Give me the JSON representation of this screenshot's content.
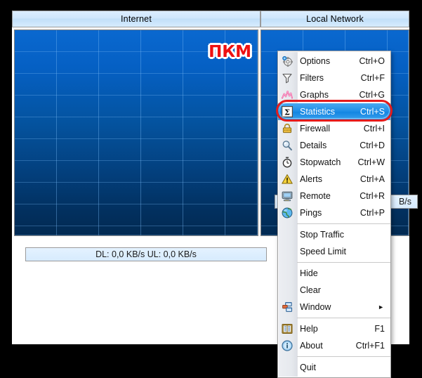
{
  "app": {
    "tabs": [
      {
        "id": "internet",
        "label": "Internet"
      },
      {
        "id": "local",
        "label": "Local Network"
      }
    ],
    "overlay_label": "ПКМ",
    "status": {
      "internet": "DL: 0,0 KB/s   UL: 0,0 KB/s",
      "local_partial": "B/s"
    },
    "colors": {
      "graph_top": "#0a68cf",
      "graph_bottom": "#022a52",
      "gridline": "#78b9f5",
      "tab_bg": "#cfe6fb",
      "status_bg": "#d7ebfe",
      "menu_bg": "#ffffff",
      "menu_gutter": "#e6e9ee",
      "selection": "#1f8ee6",
      "highlight_ring": "#e51b1b",
      "overlay_text": "#ee1111",
      "frame": "#000000"
    }
  },
  "context_menu": {
    "items": [
      {
        "label": "Options",
        "accel": "Ctrl+O",
        "icon": "gear-icon",
        "selected": false,
        "separator_after": false,
        "submenu": false
      },
      {
        "label": "Filters",
        "accel": "Ctrl+F",
        "icon": "funnel-icon",
        "selected": false,
        "separator_after": false,
        "submenu": false
      },
      {
        "label": "Graphs",
        "accel": "Ctrl+G",
        "icon": "chart-icon",
        "selected": false,
        "separator_after": false,
        "submenu": false
      },
      {
        "label": "Statistics",
        "accel": "Ctrl+S",
        "icon": "sigma-icon",
        "selected": true,
        "separator_after": false,
        "submenu": false
      },
      {
        "label": "Firewall",
        "accel": "Ctrl+I",
        "icon": "padlock-icon",
        "selected": false,
        "separator_after": false,
        "submenu": false
      },
      {
        "label": "Details",
        "accel": "Ctrl+D",
        "icon": "magnifier-icon",
        "selected": false,
        "separator_after": false,
        "submenu": false
      },
      {
        "label": "Stopwatch",
        "accel": "Ctrl+W",
        "icon": "stopwatch-icon",
        "selected": false,
        "separator_after": false,
        "submenu": false
      },
      {
        "label": "Alerts",
        "accel": "Ctrl+A",
        "icon": "warning-icon",
        "selected": false,
        "separator_after": false,
        "submenu": false
      },
      {
        "label": "Remote",
        "accel": "Ctrl+R",
        "icon": "monitor-icon",
        "selected": false,
        "separator_after": false,
        "submenu": false
      },
      {
        "label": "Pings",
        "accel": "Ctrl+P",
        "icon": "globe-icon",
        "selected": false,
        "separator_after": true,
        "submenu": false
      },
      {
        "label": "Stop Traffic",
        "accel": "",
        "icon": "",
        "selected": false,
        "separator_after": false,
        "submenu": false
      },
      {
        "label": "Speed Limit",
        "accel": "",
        "icon": "",
        "selected": false,
        "separator_after": true,
        "submenu": false
      },
      {
        "label": "Hide",
        "accel": "",
        "icon": "",
        "selected": false,
        "separator_after": false,
        "submenu": false
      },
      {
        "label": "Clear",
        "accel": "",
        "icon": "",
        "selected": false,
        "separator_after": false,
        "submenu": false
      },
      {
        "label": "Window",
        "accel": "",
        "icon": "windows-icon",
        "selected": false,
        "separator_after": true,
        "submenu": true
      },
      {
        "label": "Help",
        "accel": "F1",
        "icon": "book-icon",
        "selected": false,
        "separator_after": false,
        "submenu": false
      },
      {
        "label": "About",
        "accel": "Ctrl+F1",
        "icon": "info-icon",
        "selected": false,
        "separator_after": true,
        "submenu": false
      },
      {
        "label": "Quit",
        "accel": "",
        "icon": "",
        "selected": false,
        "separator_after": false,
        "submenu": false
      }
    ],
    "submenu_arrow": "►"
  }
}
